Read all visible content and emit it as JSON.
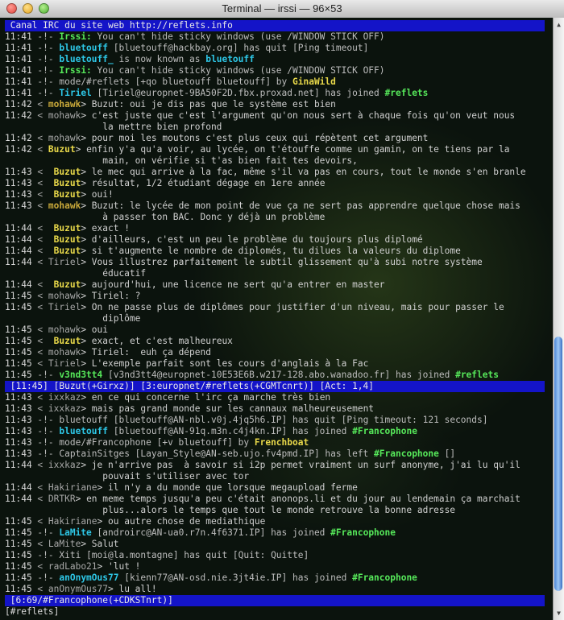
{
  "window": {
    "title": "Terminal — irssi — 96×53"
  },
  "top_bar": {
    "text": " Canal IRC du site web http://reflets.info"
  },
  "pane_a": [
    [
      [
        "11:41",
        "ts"
      ],
      [
        " -!- ",
        "ev"
      ],
      [
        "Irssi:",
        "green"
      ],
      [
        " You can't hide sticky windows (use /WINDOW STICK OFF)",
        "ev"
      ]
    ],
    [
      [
        "11:41",
        "ts"
      ],
      [
        " -!- ",
        "ev"
      ],
      [
        "bluetouff",
        "cyan"
      ],
      [
        " [bluetouff@hackbay.org] has quit [Ping timeout]",
        "ev"
      ]
    ],
    [
      [
        "11:41",
        "ts"
      ],
      [
        " -!- ",
        "ev"
      ],
      [
        "bluetouff_",
        "cyan"
      ],
      [
        " is now known as ",
        "ev"
      ],
      [
        "bluetouff",
        "cyan"
      ]
    ],
    [
      [
        "11:41",
        "ts"
      ],
      [
        " -!- ",
        "ev"
      ],
      [
        "Irssi:",
        "green"
      ],
      [
        " You can't hide sticky windows (use /WINDOW STICK OFF)",
        "ev"
      ]
    ],
    [
      [
        "11:41",
        "ts"
      ],
      [
        " -!- ",
        "ev"
      ],
      [
        "mode/#reflets [+qo bluetouff bluetouff] by ",
        "ev"
      ],
      [
        "GinaWild",
        "yellow"
      ]
    ],
    [
      [
        "11:41",
        "ts"
      ],
      [
        " -!- ",
        "ev"
      ],
      [
        "Tiriel",
        "cyan"
      ],
      [
        " [Tiriel@europnet-9BA50F2D.fbx.proxad.net] has joined ",
        "ev"
      ],
      [
        "#reflets",
        "green"
      ]
    ],
    [
      [
        "11:42",
        "ts"
      ],
      [
        " < ",
        "nk"
      ],
      [
        "mohawk",
        "gold"
      ],
      [
        "> Buzut: oui je dis pas que le système est bien",
        "msg"
      ]
    ],
    [
      [
        "11:42",
        "ts"
      ],
      [
        " < ",
        "nk"
      ],
      [
        "mohawk",
        "nk"
      ],
      [
        "> c'est juste que c'est l'argument qu'on nous sert à chaque fois qu'on veut nous",
        "msg"
      ]
    ],
    [
      [
        "",
        "ts"
      ],
      [
        "                  la mettre bien profond",
        "msg"
      ]
    ],
    [
      [
        "11:42",
        "ts"
      ],
      [
        " < ",
        "nk"
      ],
      [
        "mohawk",
        "nk"
      ],
      [
        "> pour moi les moutons c'est plus ceux qui répètent cet argument",
        "msg"
      ]
    ],
    [
      [
        "11:42",
        "ts"
      ],
      [
        " < ",
        "nk"
      ],
      [
        "Buzut",
        "yellow"
      ],
      [
        "> enfin y'a qu'a voir, au lycée, on t'étouffe comme un gamin, on te tiens par la",
        "msg"
      ]
    ],
    [
      [
        "",
        "ts"
      ],
      [
        "                  main, on vérifie si t'as bien fait tes devoirs,",
        "msg"
      ]
    ],
    [
      [
        "11:43",
        "ts"
      ],
      [
        " <  ",
        "nk"
      ],
      [
        "Buzut",
        "yellow"
      ],
      [
        "> le mec qui arrive à la fac, même s'il va pas en cours, tout le monde s'en branle",
        "msg"
      ]
    ],
    [
      [
        "11:43",
        "ts"
      ],
      [
        " <  ",
        "nk"
      ],
      [
        "Buzut",
        "yellow"
      ],
      [
        "> résultat, 1/2 étudiant dégage en 1ere année",
        "msg"
      ]
    ],
    [
      [
        "11:43",
        "ts"
      ],
      [
        " <  ",
        "nk"
      ],
      [
        "Buzut",
        "yellow"
      ],
      [
        "> oui!",
        "msg"
      ]
    ],
    [
      [
        "11:43",
        "ts"
      ],
      [
        " < ",
        "nk"
      ],
      [
        "mohawk",
        "gold"
      ],
      [
        "> Buzut: le lycée de mon point de vue ça ne sert pas apprendre quelque chose mais",
        "msg"
      ]
    ],
    [
      [
        "",
        "ts"
      ],
      [
        "                  à passer ton BAC. Donc y déjà un problème",
        "msg"
      ]
    ],
    [
      [
        "11:44",
        "ts"
      ],
      [
        " <  ",
        "nk"
      ],
      [
        "Buzut",
        "yellow"
      ],
      [
        "> exact !",
        "msg"
      ]
    ],
    [
      [
        "11:44",
        "ts"
      ],
      [
        " <  ",
        "nk"
      ],
      [
        "Buzut",
        "yellow"
      ],
      [
        "> d'ailleurs, c'est un peu le problème du toujours plus diplomé",
        "msg"
      ]
    ],
    [
      [
        "11:44",
        "ts"
      ],
      [
        " <  ",
        "nk"
      ],
      [
        "Buzut",
        "yellow"
      ],
      [
        "> si t'augmente le nombre de diplomés, tu dilues la valeurs du diplome",
        "msg"
      ]
    ],
    [
      [
        "11:44",
        "ts"
      ],
      [
        " < ",
        "nk"
      ],
      [
        "Tiriel",
        "nk"
      ],
      [
        "> Vous illustrez parfaitement le subtil glissement qu'à subi notre système",
        "msg"
      ]
    ],
    [
      [
        "",
        "ts"
      ],
      [
        "                  éducatif",
        "msg"
      ]
    ],
    [
      [
        "11:44",
        "ts"
      ],
      [
        " <  ",
        "nk"
      ],
      [
        "Buzut",
        "yellow"
      ],
      [
        "> aujourd'hui, une licence ne sert qu'a entrer en master",
        "msg"
      ]
    ],
    [
      [
        "11:45",
        "ts"
      ],
      [
        " < ",
        "nk"
      ],
      [
        "mohawk",
        "nk"
      ],
      [
        "> Tiriel: ?",
        "msg"
      ]
    ],
    [
      [
        "11:45",
        "ts"
      ],
      [
        " < ",
        "nk"
      ],
      [
        "Tiriel",
        "nk"
      ],
      [
        "> On ne passe plus de diplômes pour justifier d'un niveau, mais pour passer le",
        "msg"
      ]
    ],
    [
      [
        "",
        "ts"
      ],
      [
        "                  diplôme",
        "msg"
      ]
    ],
    [
      [
        "11:45",
        "ts"
      ],
      [
        " < ",
        "nk"
      ],
      [
        "mohawk",
        "nk"
      ],
      [
        "> oui",
        "msg"
      ]
    ],
    [
      [
        "11:45",
        "ts"
      ],
      [
        " <  ",
        "nk"
      ],
      [
        "Buzut",
        "yellow"
      ],
      [
        "> exact, et c'est malheureux",
        "msg"
      ]
    ],
    [
      [
        "11:45",
        "ts"
      ],
      [
        " < ",
        "nk"
      ],
      [
        "mohawk",
        "nk"
      ],
      [
        "> Tiriel:  euh ça dépend",
        "msg"
      ]
    ],
    [
      [
        "11:45",
        "ts"
      ],
      [
        " < ",
        "nk"
      ],
      [
        "Tiriel",
        "nk"
      ],
      [
        "> L'exemple parfait sont les cours d'anglais à la Fac",
        "msg"
      ]
    ],
    [
      [
        "11:45",
        "ts"
      ],
      [
        " -!- ",
        "ev"
      ],
      [
        "v3nd3tt4",
        "green"
      ],
      [
        " [v3nd3tt4@europnet-10E53E6B.w217-128.abo.wanadoo.fr] has joined ",
        "ev"
      ],
      [
        "#reflets",
        "green"
      ]
    ]
  ],
  "mid_bar": {
    "text": " [11:45] [Buzut(+Girxz)] [3:europnet/#reflets(+CGMTcnrt)] [Act: 1,4]"
  },
  "pane_b": [
    [
      [
        "11:43",
        "ts"
      ],
      [
        " < ",
        "nk"
      ],
      [
        "ixxkaz",
        "nk"
      ],
      [
        "> en ce qui concerne l'irc ça marche très bien",
        "msg"
      ]
    ],
    [
      [
        "11:43",
        "ts"
      ],
      [
        " < ",
        "nk"
      ],
      [
        "ixxkaz",
        "nk"
      ],
      [
        "> mais pas grand monde sur les cannaux malheureusement",
        "msg"
      ]
    ],
    [
      [
        "11:43",
        "ts"
      ],
      [
        " -!- ",
        "ev"
      ],
      [
        "bluetouff",
        "ev"
      ],
      [
        " [bluetouff@AN-nbl.v0j.4jq5h6.IP] has quit [Ping timeout: 121 seconds]",
        "ev"
      ]
    ],
    [
      [
        "11:43",
        "ts"
      ],
      [
        " -!- ",
        "ev"
      ],
      [
        "bluetouff",
        "cyan"
      ],
      [
        " [bluetouff@AN-91q.m3n.c4j4kn.IP] has joined ",
        "ev"
      ],
      [
        "#Francophone",
        "green"
      ]
    ],
    [
      [
        "11:43",
        "ts"
      ],
      [
        " -!- ",
        "ev"
      ],
      [
        "mode/#Francophone [+v bluetouff] by ",
        "ev"
      ],
      [
        "Frenchboat",
        "yellow"
      ]
    ],
    [
      [
        "11:43",
        "ts"
      ],
      [
        " -!- ",
        "ev"
      ],
      [
        "CaptainSitges",
        "ev"
      ],
      [
        " [Layan_Style@AN-seb.ujo.fv4pmd.IP] has left ",
        "ev"
      ],
      [
        "#Francophone",
        "green"
      ],
      [
        " []",
        "ev"
      ]
    ],
    [
      [
        "11:44",
        "ts"
      ],
      [
        " < ",
        "nk"
      ],
      [
        "ixxkaz",
        "nk"
      ],
      [
        "> je n'arrive pas  à savoir si i2p permet vraiment un surf anonyme, j'ai lu qu'il",
        "msg"
      ]
    ],
    [
      [
        "",
        "ts"
      ],
      [
        "                  pouvait s'utiliser avec tor",
        "msg"
      ]
    ],
    [
      [
        "11:44",
        "ts"
      ],
      [
        " < ",
        "nk"
      ],
      [
        "Hakiriane",
        "nk"
      ],
      [
        "> il n'y a du monde que lorsque megaupload ferme",
        "msg"
      ]
    ],
    [
      [
        "11:44",
        "ts"
      ],
      [
        " < ",
        "nk"
      ],
      [
        "DRTKR",
        "nk"
      ],
      [
        "> en meme temps jusqu'a peu c'était anonops.li et du jour au lendemain ça marchait",
        "msg"
      ]
    ],
    [
      [
        "",
        "ts"
      ],
      [
        "                  plus...alors le temps que tout le monde retrouve la bonne adresse",
        "msg"
      ]
    ],
    [
      [
        "11:45",
        "ts"
      ],
      [
        " < ",
        "nk"
      ],
      [
        "Hakiriane",
        "nk"
      ],
      [
        "> ou autre chose de mediathique",
        "msg"
      ]
    ],
    [
      [
        "11:45",
        "ts"
      ],
      [
        " -!- ",
        "ev"
      ],
      [
        "LaMite",
        "cyan"
      ],
      [
        " [androirc@AN-ua0.r7n.4f6371.IP] has joined ",
        "ev"
      ],
      [
        "#Francophone",
        "green"
      ]
    ],
    [
      [
        "11:45",
        "ts"
      ],
      [
        " < ",
        "nk"
      ],
      [
        "LaMite",
        "nk"
      ],
      [
        "> Salut",
        "msg"
      ]
    ],
    [
      [
        "11:45",
        "ts"
      ],
      [
        " -!- ",
        "ev"
      ],
      [
        "Xiti",
        "ev"
      ],
      [
        " [moi@la.montagne] has quit [Quit: Quitte]",
        "ev"
      ]
    ],
    [
      [
        "11:45",
        "ts"
      ],
      [
        " < ",
        "nk"
      ],
      [
        "radLabo21",
        "nk"
      ],
      [
        "> 'lut !",
        "msg"
      ]
    ],
    [
      [
        "11:45",
        "ts"
      ],
      [
        " -!- ",
        "ev"
      ],
      [
        "anOnymOus77",
        "cyan"
      ],
      [
        " [kienn77@AN-osd.nie.3jt4ie.IP] has joined ",
        "ev"
      ],
      [
        "#Francophone",
        "green"
      ]
    ],
    [
      [
        "11:45",
        "ts"
      ],
      [
        " < ",
        "nk"
      ],
      [
        "anOnymOus77",
        "nk"
      ],
      [
        "> lu all!",
        "msg"
      ]
    ]
  ],
  "bottom_bar": {
    "text": " [6:69/#Francophone(+CDKSTnrt)]"
  },
  "prompt": {
    "text": "[#reflets] "
  },
  "scroll": {
    "position_fraction": 0.53,
    "visible_fraction": 0.44
  },
  "colors": {
    "status_bar": "#1414c8",
    "nick_highlight": "#2ec8e8",
    "channel": "#56e85a",
    "mode_nick": "#e8d84a"
  }
}
